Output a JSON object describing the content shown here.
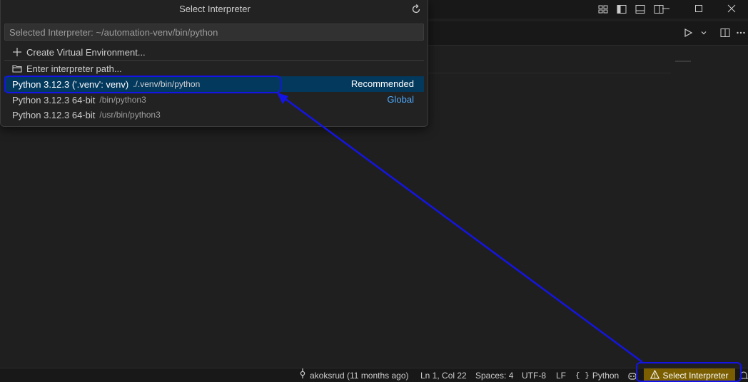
{
  "quickpick": {
    "title": "Select Interpreter",
    "input_placeholder": "Selected Interpreter: ~/automation-venv/bin/python",
    "actions": [
      {
        "icon": "plus-icon",
        "label": "Create Virtual Environment..."
      },
      {
        "icon": "folder-icon",
        "label": "Enter interpreter path..."
      }
    ],
    "interpreters": [
      {
        "label": "Python 3.12.3 ('.venv': venv)",
        "path": "./.venv/bin/python",
        "tag": "Recommended",
        "selected": true
      },
      {
        "label": "Python 3.12.3 64-bit",
        "path": "/bin/python3",
        "tag": "Global",
        "selected": false
      },
      {
        "label": "Python 3.12.3 64-bit",
        "path": "/usr/bin/python3",
        "tag": "",
        "selected": false
      }
    ]
  },
  "statusbar": {
    "git_blame": "akoksrud (11 months ago)",
    "cursor_position": "Ln 1, Col 22",
    "indentation": "Spaces: 4",
    "encoding": "UTF-8",
    "eol": "LF",
    "language": "Python",
    "select_interpreter": "Select Interpreter"
  },
  "colors": {
    "selected_row": "#04395e",
    "global_link": "#4daafc",
    "warning_background": "#7a5e00",
    "annotation": "#1414e6"
  }
}
